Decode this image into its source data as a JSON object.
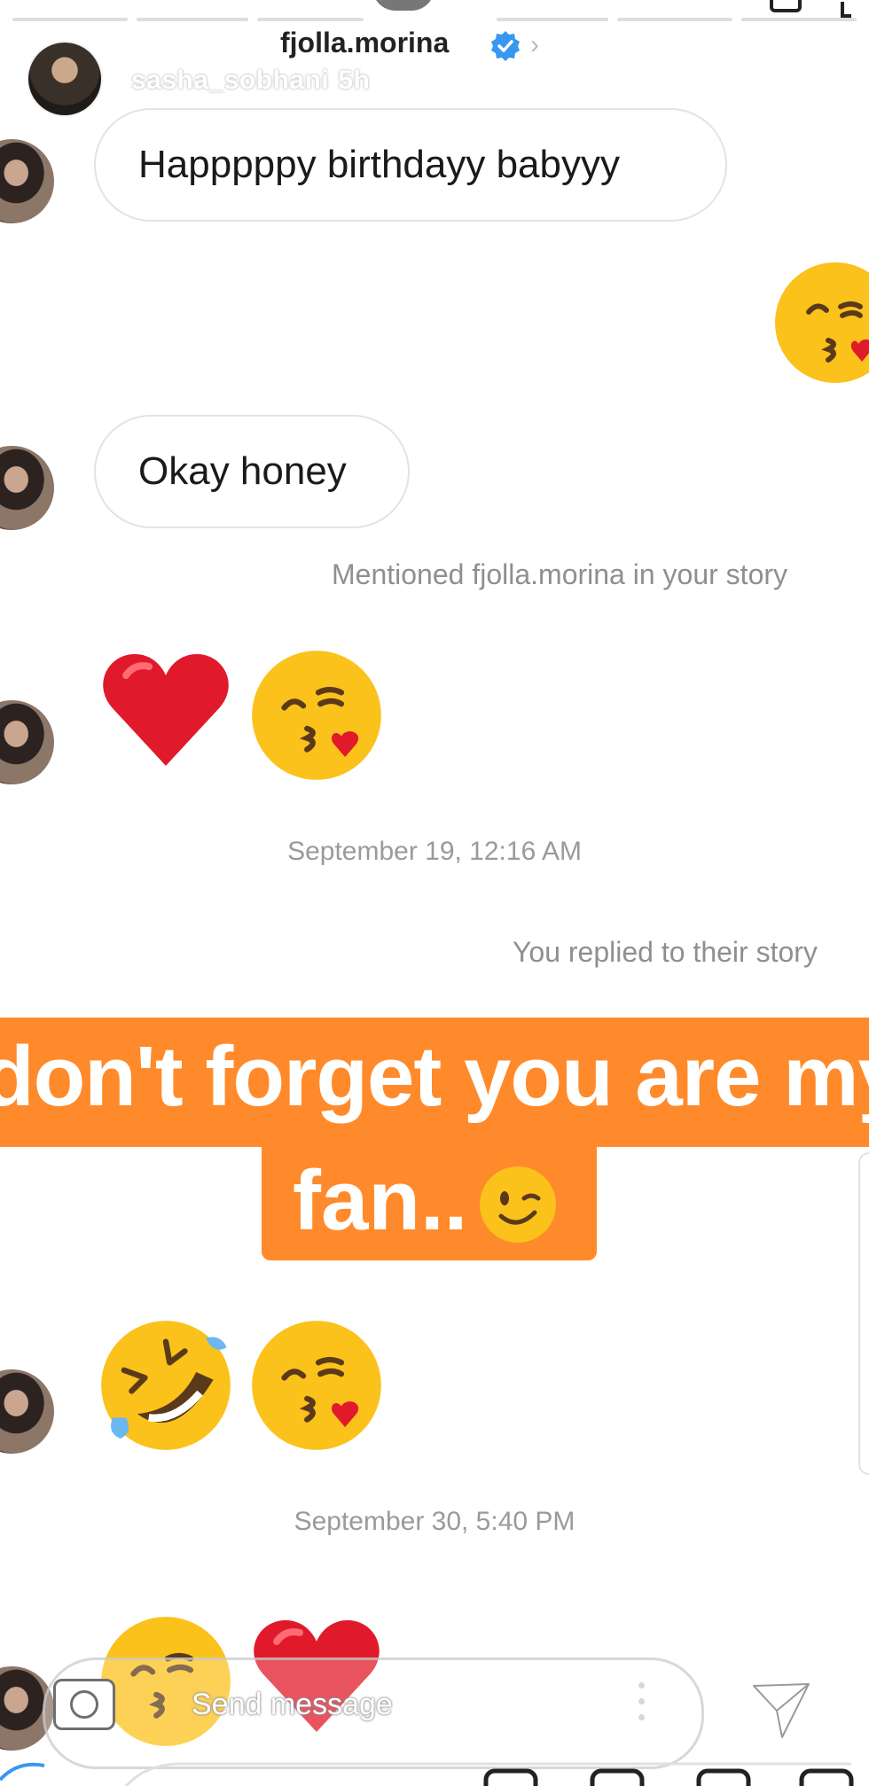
{
  "header": {
    "username": "fjolla.morina",
    "chevron": "›",
    "sub_user": "sasha_sobhani",
    "sub_time": "5h"
  },
  "messages": {
    "first": "Happpppy birthdayy babyyy",
    "second": "Okay honey",
    "mention_notice": "Mentioned fjolla.morina in your story",
    "timestamp_1": "September 19, 12:16 AM",
    "reply_notice": "You replied to their story",
    "timestamp_2": "September 30, 5:40 PM"
  },
  "story_reply": {
    "line1": "don't forget you are my",
    "line2": "fan.."
  },
  "composer": {
    "placeholder": "Send message"
  },
  "icons": {
    "verified": "verified-badge-icon",
    "camera": "camera-icon",
    "send": "send-icon",
    "more": "more-dots-icon",
    "emoji": [
      "kissing-heart-emoji",
      "red-heart-emoji",
      "rolling-laughing-emoji",
      "winking-emoji"
    ]
  },
  "colors": {
    "story_orange": "#ff8a2b",
    "verified_blue": "#3897f0",
    "emoji_yellow": "#fbc21c",
    "heart_red": "#e01a2b"
  }
}
